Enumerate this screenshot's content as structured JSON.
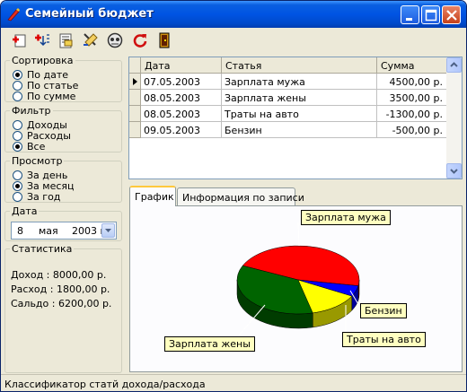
{
  "window": {
    "title": "Семейный бюджет"
  },
  "toolbar": {
    "buttons": [
      {
        "icon": "add-record-icon"
      },
      {
        "icon": "add-transfer-icon"
      },
      {
        "icon": "edit-record-icon"
      },
      {
        "icon": "classifier-icon"
      },
      {
        "icon": "reports-icon"
      },
      {
        "icon": "refresh-icon"
      },
      {
        "icon": "exit-icon"
      }
    ]
  },
  "sorting": {
    "title": "Сортировка",
    "options": [
      "По дате",
      "По статье",
      "По сумме"
    ],
    "selected": 0
  },
  "filter": {
    "title": "Фильтр",
    "options": [
      "Доходы",
      "Расходы",
      "Все"
    ],
    "selected": 2
  },
  "view": {
    "title": "Просмотр",
    "options": [
      "За день",
      "За месяц",
      "За год"
    ],
    "selected": 1
  },
  "date": {
    "title": "Дата",
    "day": "8",
    "month": "мая",
    "year": "2003 г."
  },
  "stats": {
    "title": "Статистика",
    "income": "Доход : 8000,00 р.",
    "expense": "Расход : 1800,00 р.",
    "balance": "Сальдо : 6200,00 р."
  },
  "grid": {
    "columns": [
      "Дата",
      "Статья",
      "Сумма"
    ],
    "rows": [
      {
        "date": "07.05.2003",
        "item": "Зарплата мужа",
        "amount": "4500,00 р."
      },
      {
        "date": "08.05.2003",
        "item": "Зарплата жены",
        "amount": "3500,00 р."
      },
      {
        "date": "08.05.2003",
        "item": "Траты на авто",
        "amount": "-1300,00 р."
      },
      {
        "date": "09.05.2003",
        "item": "Бензин",
        "amount": "-500,00 р."
      }
    ],
    "current_row": 0
  },
  "tabs": [
    "График",
    "Информация по записи"
  ],
  "active_tab": 0,
  "chart_data": {
    "type": "pie",
    "categories": [
      "Зарплата мужа",
      "Зарплата жены",
      "Траты на авто",
      "Бензин"
    ],
    "values": [
      4500,
      3500,
      1300,
      500
    ],
    "colors": [
      "#ff0000",
      "#006400",
      "#ffff00",
      "#0000ff"
    ],
    "three_d": true
  },
  "statusbar": {
    "text": "Классификатор статй дохода/расхода"
  },
  "colors": {
    "titlebar": "#0054e3",
    "face": "#ece9d8",
    "label_bg": "#ffffc0"
  }
}
